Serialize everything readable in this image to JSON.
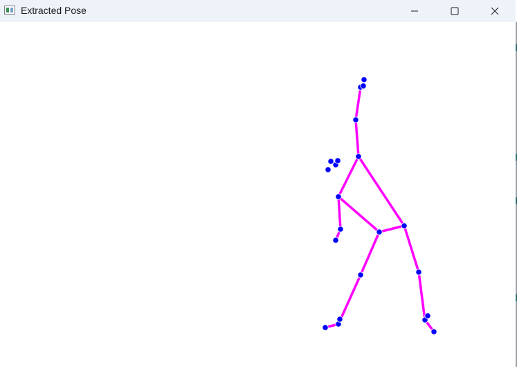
{
  "window": {
    "title": "Extracted Pose",
    "icon": "opencv-window-icon",
    "controls": {
      "minimize": "minimize-icon",
      "maximize": "maximize-icon",
      "close": "close-icon"
    }
  },
  "pose": {
    "bone_color": "#ff00ff",
    "joint_color": "#0000ff",
    "background_color": "#ffffff"
  }
}
